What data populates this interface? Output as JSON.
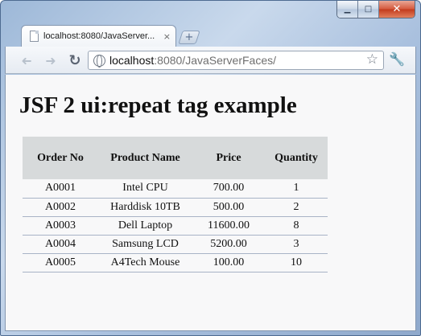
{
  "browser": {
    "tab_title": "localhost:8080/JavaServer...",
    "tab_close": "×",
    "new_tab": "+",
    "url_host": "localhost",
    "url_rest": ":8080/JavaServerFaces/",
    "icons": [
      "back-icon",
      "forward-icon",
      "reload-icon",
      "globe-icon",
      "star-icon",
      "wrench-icon",
      "minimize-icon",
      "maximize-icon",
      "close-icon"
    ]
  },
  "page": {
    "heading": "JSF 2 ui:repeat tag example"
  },
  "table": {
    "headers": [
      "Order No",
      "Product Name",
      "Price",
      "Quantity"
    ],
    "rows": [
      [
        "A0001",
        "Intel CPU",
        "700.00",
        "1"
      ],
      [
        "A0002",
        "Harddisk 10TB",
        "500.00",
        "2"
      ],
      [
        "A0003",
        "Dell Laptop",
        "11600.00",
        "8"
      ],
      [
        "A0004",
        "Samsung LCD",
        "5200.00",
        "3"
      ],
      [
        "A0005",
        "A4Tech Mouse",
        "100.00",
        "10"
      ]
    ]
  }
}
